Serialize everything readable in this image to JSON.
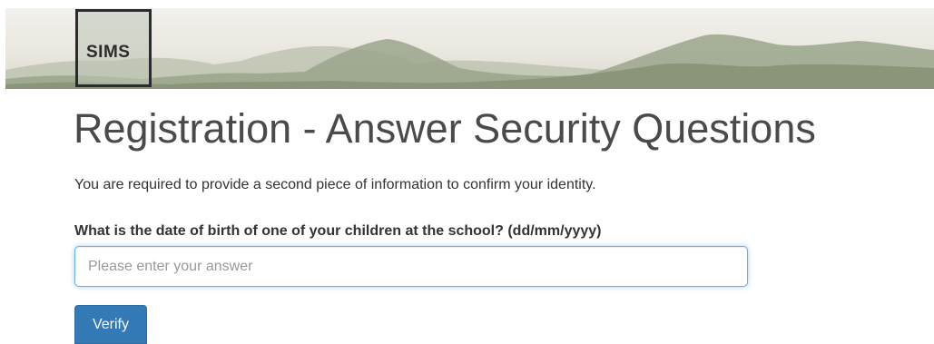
{
  "header": {
    "logo_text": "SIMS"
  },
  "main": {
    "title": "Registration - Answer Security Questions",
    "intro": "You are required to provide a second piece of information to confirm your identity.",
    "question_label": "What is the date of birth of one of your children at the school? (dd/mm/yyyy)",
    "answer_input": {
      "value": "",
      "placeholder": "Please enter your answer"
    },
    "verify_label": "Verify"
  },
  "colors": {
    "primary_button": "#337ab7",
    "input_focus_border": "#66afe9",
    "title_text": "#4a4a4a",
    "body_text": "#333333"
  }
}
